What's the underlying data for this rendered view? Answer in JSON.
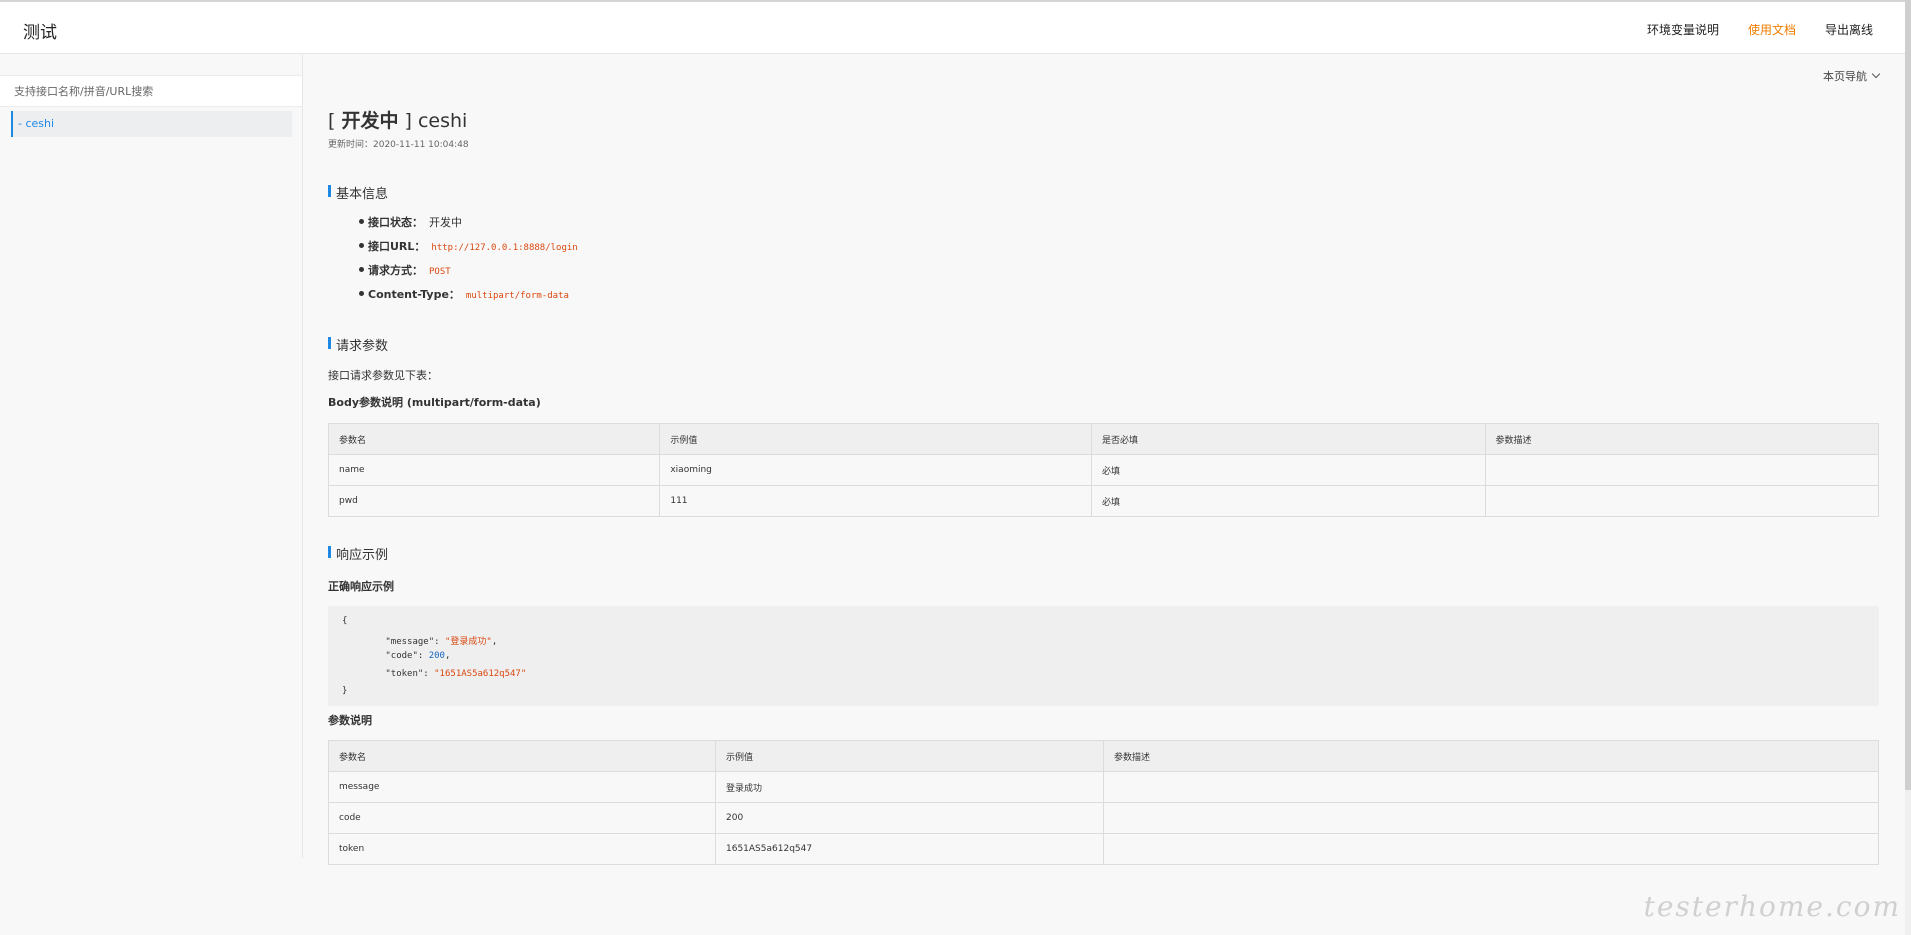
{
  "header": {
    "title": "测试",
    "nav": [
      "环境变量说明",
      "使用文档",
      "导出离线"
    ],
    "active_nav": "使用文档"
  },
  "sidebar": {
    "search_placeholder": "支持接口名称/拼音/URL搜索",
    "items": [
      {
        "label": "- ceshi"
      }
    ]
  },
  "page_nav": {
    "label": "本页导航",
    "icon": "chevron-down-icon"
  },
  "api": {
    "title_prefix": "[ ",
    "status": "开发中",
    "title_suffix": " ] ceshi",
    "updated": "更新时间：2020-11-11 10:04:48"
  },
  "basic_info": {
    "heading": "基本信息",
    "items": [
      {
        "key": "接口状态：",
        "value": "开发中"
      },
      {
        "key": "接口URL：",
        "value": "http://127.0.0.1:8888/login"
      },
      {
        "key": "请求方式：",
        "value": "POST"
      },
      {
        "key": "Content-Type：",
        "value": "multipart/form-data"
      }
    ]
  },
  "request_params": {
    "heading": "请求参数",
    "intro": "接口请求参数见下表：",
    "body_title": "Body参数说明 (multipart/form-data)",
    "columns": [
      "参数名",
      "示例值",
      "是否必填",
      "参数描述"
    ],
    "rows": [
      [
        "name",
        "xiaoming",
        "必填",
        ""
      ],
      [
        "pwd",
        "111",
        "必填",
        ""
      ]
    ]
  },
  "response": {
    "heading": "响应示例",
    "success_title": "正确响应示例",
    "code_lines": {
      "open": "{",
      "l1_key": "\"message\"",
      "l1_val": "\"登录成功\"",
      "l2_key": "\"code\"",
      "l2_val": "200",
      "l3_key": "\"token\"",
      "l3_val": "\"1651AS5a612q547\"",
      "close": "}"
    },
    "params_title": "参数说明",
    "columns": [
      "参数名",
      "示例值",
      "参数描述"
    ],
    "rows": [
      [
        "message",
        "登录成功",
        ""
      ],
      [
        "code",
        "200",
        ""
      ],
      [
        "token",
        "1651AS5a612q547",
        ""
      ]
    ]
  },
  "watermark": "testerhome.com",
  "colors": {
    "accent": "#1e88e5",
    "active_nav": "#ef7d00",
    "code": "#d9480f"
  }
}
